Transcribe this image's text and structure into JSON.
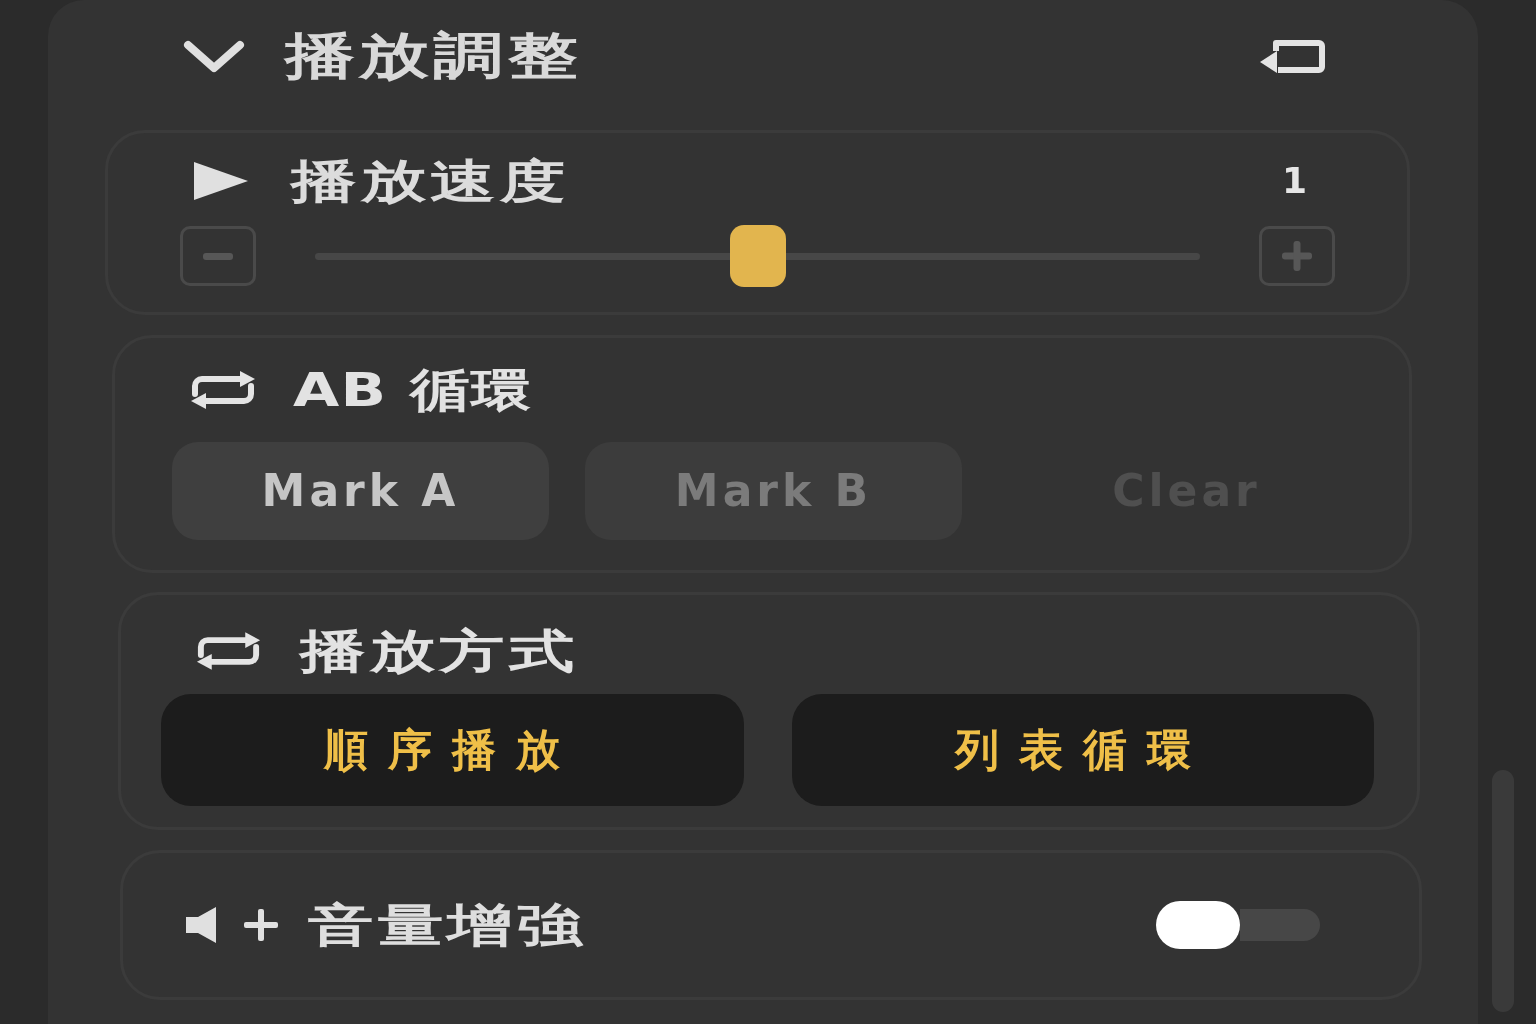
{
  "header": {
    "title": "播放調整",
    "expanded": true
  },
  "speed": {
    "title": "播放速度",
    "value": "1",
    "level": 0.5
  },
  "ab_loop": {
    "title": "AB 循環",
    "buttons": [
      {
        "label": "Mark A",
        "kind": "filled",
        "disabled": false
      },
      {
        "label": "Mark B",
        "kind": "filled",
        "disabled": true
      },
      {
        "label": "Clear",
        "kind": "ghost",
        "disabled": true
      }
    ]
  },
  "play_mode": {
    "title": "播放方式",
    "options": [
      {
        "label": "順序播放"
      },
      {
        "label": "列表循環"
      }
    ]
  },
  "volume_boost": {
    "title": "音量增強",
    "on": false
  }
}
